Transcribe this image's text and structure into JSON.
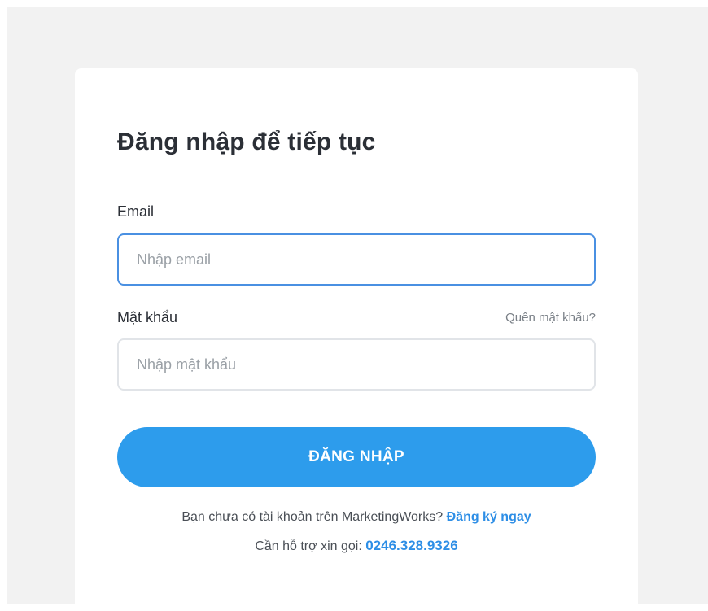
{
  "login": {
    "title": "Đăng nhập để tiếp tục",
    "email_label": "Email",
    "email_placeholder": "Nhập email",
    "email_value": "",
    "password_label": "Mật khẩu",
    "forgot_password": "Quên mật khẩu?",
    "password_placeholder": "Nhập mật khẩu",
    "password_value": "",
    "submit_label": "ĐĂNG NHẬP",
    "signup_prompt": "Bạn chưa có tài khoản trên MarketingWorks?",
    "signup_link": "Đăng ký ngay",
    "support_prompt": "Cần hỗ trợ xin gọi:",
    "support_phone": "0246.328.9326"
  },
  "colors": {
    "page_background": "#f2f2f2",
    "card_background": "#ffffff",
    "primary_button": "#2d9cec",
    "link": "#2d8ee6",
    "focused_border": "#4a90e2"
  }
}
